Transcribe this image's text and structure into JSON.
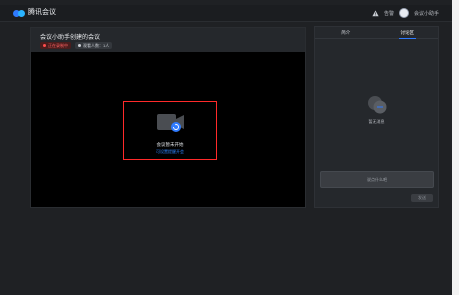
{
  "app": {
    "name": "腾讯会议"
  },
  "topbar": {
    "warning_label": "告警",
    "user_name": "会议小助手"
  },
  "meeting": {
    "title": "会议小助手创建的会议",
    "badges": [
      {
        "label": "正在录制中"
      },
      {
        "label": "观看人数：1人"
      }
    ]
  },
  "share": {
    "status": "会议暂未开始",
    "link": "可设置提醒开会"
  },
  "sidebar": {
    "tabs": [
      {
        "label": "简介"
      },
      {
        "label": "讨论区"
      }
    ],
    "empty_text": "暂无消息",
    "input_placeholder": "说点什么吧",
    "send_label": "发送"
  },
  "colors": {
    "accent": "#2f7bff",
    "highlight": "#ff2a2a",
    "background": "#1f2124"
  }
}
